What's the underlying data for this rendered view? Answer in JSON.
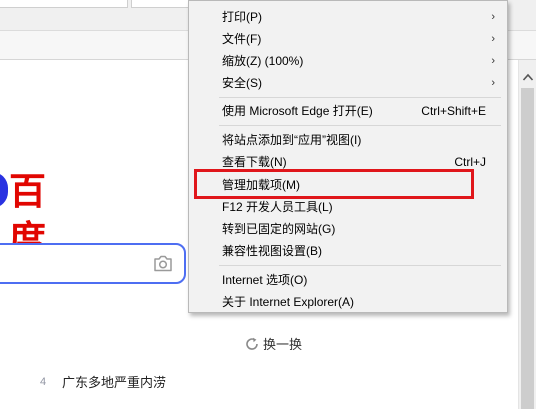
{
  "menu": {
    "items": [
      {
        "label": "打印(P)",
        "submenu": true
      },
      {
        "label": "文件(F)",
        "submenu": true
      },
      {
        "label": "缩放(Z) (100%)",
        "submenu": true
      },
      {
        "label": "安全(S)",
        "submenu": true
      },
      {
        "label": "使用 Microsoft Edge 打开(E)",
        "shortcut": "Ctrl+Shift+E"
      },
      {
        "label": "将站点添加到“应用”视图(I)"
      },
      {
        "label": "查看下载(N)",
        "shortcut": "Ctrl+J"
      },
      {
        "label": "管理加载项(M)"
      },
      {
        "label": "F12 开发人员工具(L)"
      },
      {
        "label": "转到已固定的网站(G)"
      },
      {
        "label": "兼容性视图设置(B)"
      },
      {
        "label": "Internet 选项(O)"
      },
      {
        "label": "关于 Internet Explorer(A)"
      }
    ],
    "submenu_arrow": "›"
  },
  "page": {
    "logo_text": "百度",
    "refresh_label": "换一换",
    "hot_list": [
      {
        "rank": "4",
        "title": "广东多地严重内涝"
      }
    ]
  },
  "icons": {
    "camera": "camera-icon",
    "refresh": "refresh-icon",
    "scroll_up": "scroll-up-arrow-icon"
  },
  "colors": {
    "highlight": "#e0161b",
    "baidu_red": "#e10601",
    "baidu_blue": "#2932e1",
    "search_border": "#4e6ef2"
  }
}
